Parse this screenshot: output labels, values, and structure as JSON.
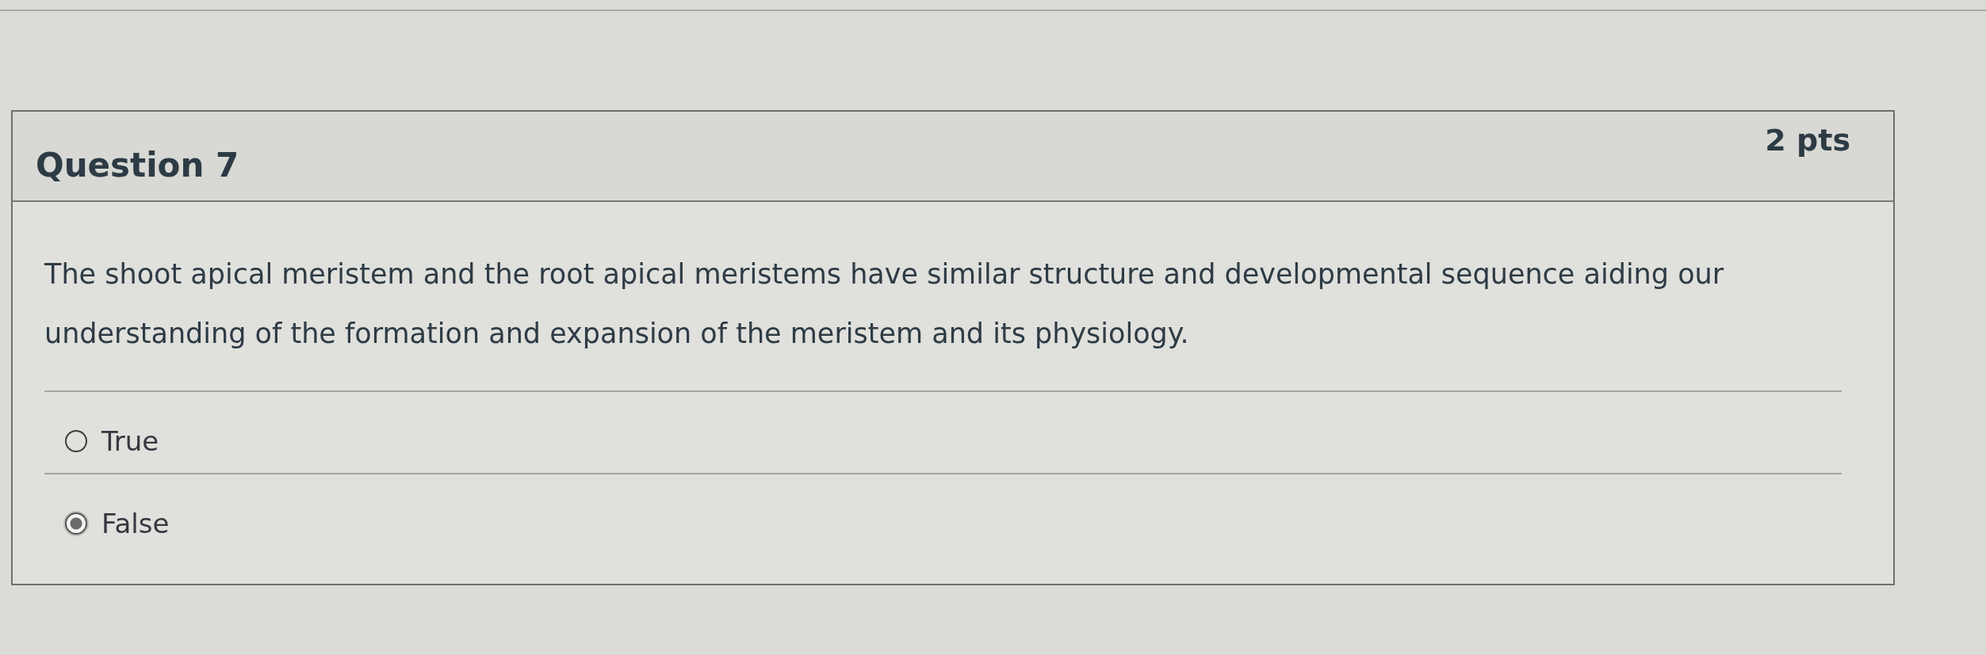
{
  "question": {
    "title": "Question 7",
    "points": "2 pts"
  },
  "prompt": "The shoot apical meristem and the root apical meristems have similar structure and developmental sequence aiding our understanding of the formation and expansion of the meristem and its physiology.",
  "answers": [
    {
      "label": "True",
      "selected": false
    },
    {
      "label": "False",
      "selected": true
    }
  ]
}
